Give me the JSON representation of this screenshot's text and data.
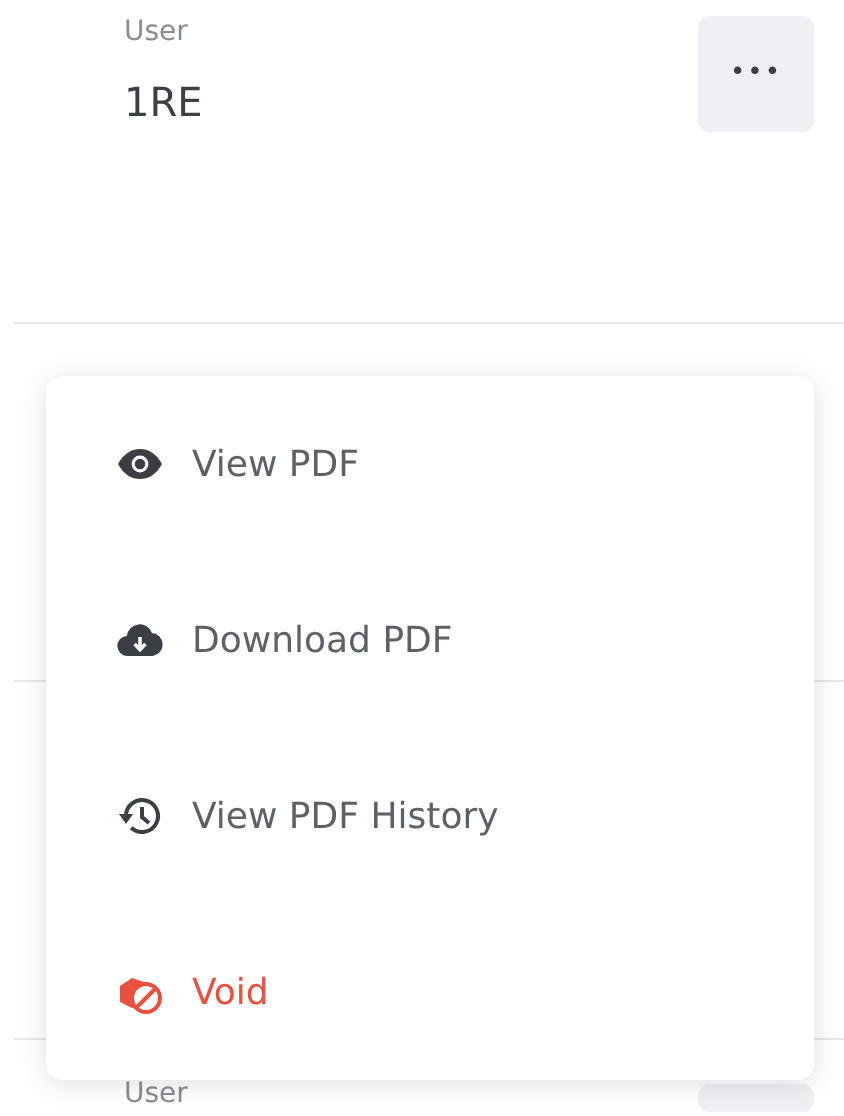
{
  "rows": [
    {
      "label": "User",
      "value": "1RE",
      "more": "•••"
    },
    {
      "label": "User"
    }
  ],
  "menu": [
    {
      "kind": "view",
      "label": "View PDF"
    },
    {
      "kind": "download",
      "label": "Download PDF"
    },
    {
      "kind": "history",
      "label": "View PDF History"
    },
    {
      "kind": "void",
      "label": "Void"
    }
  ]
}
